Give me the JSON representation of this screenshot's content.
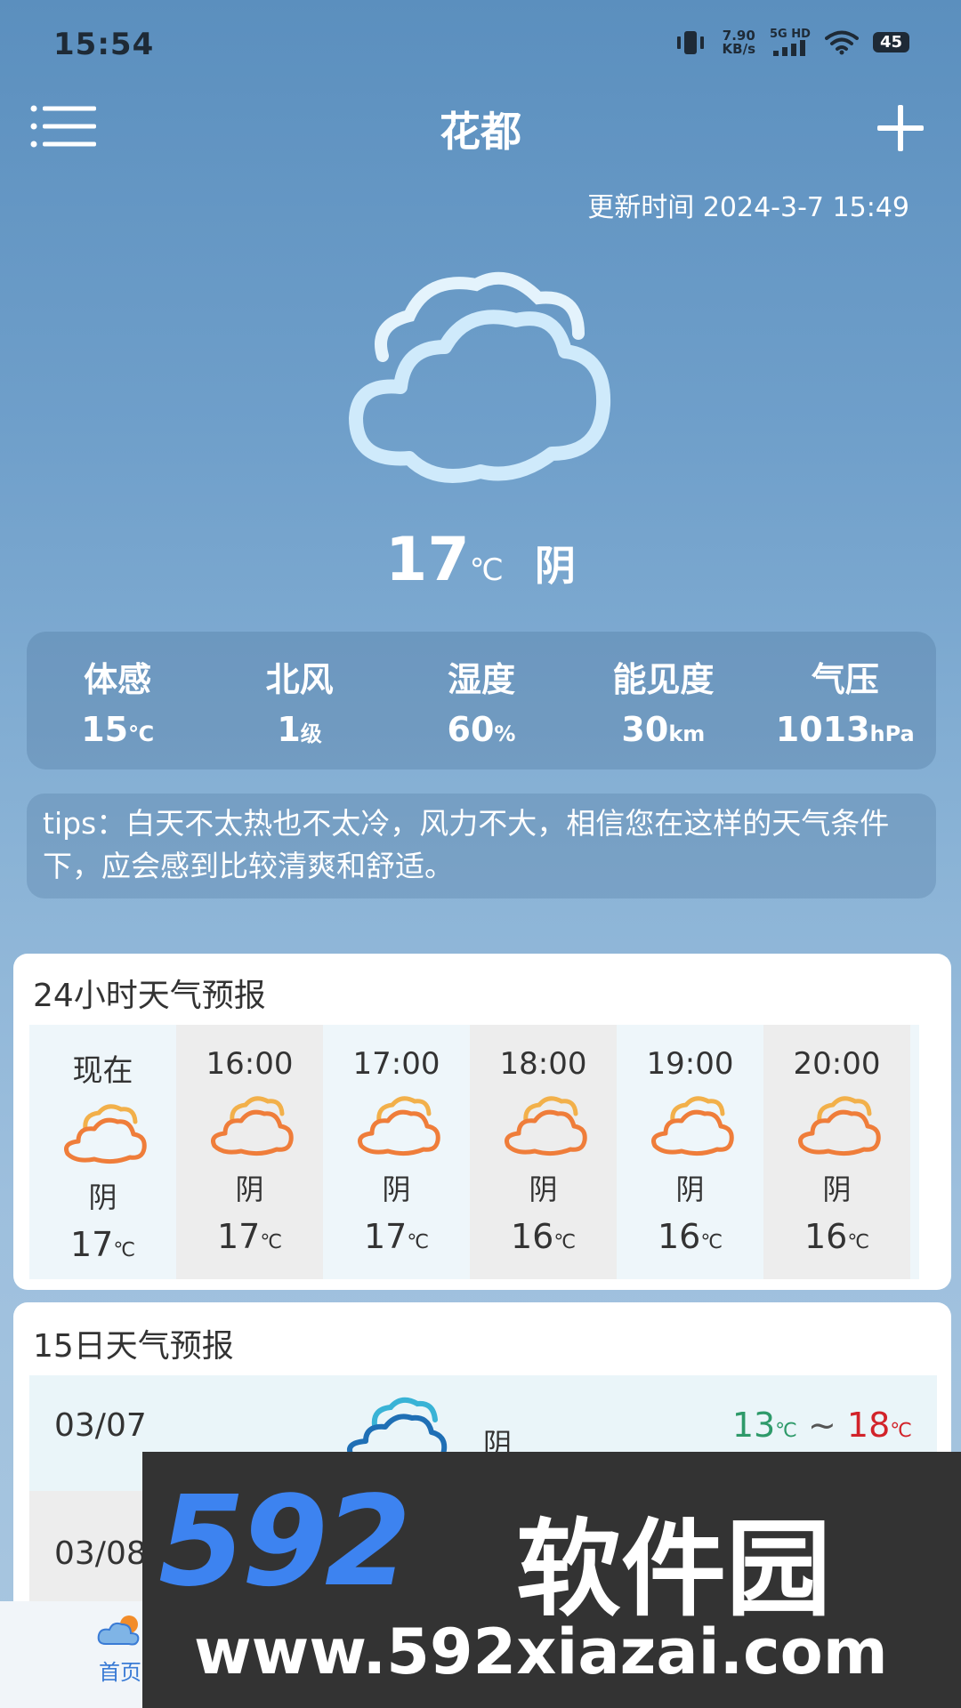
{
  "status_bar": {
    "time": "15:54",
    "net_speed_value": "7.90",
    "net_speed_unit": "KB/s",
    "signal_label": "5G HD",
    "battery": "45"
  },
  "header": {
    "title": "花都",
    "update_time": "更新时间 2024-3-7 15:49"
  },
  "current": {
    "temp": "17",
    "unit": "℃",
    "condition": "阴"
  },
  "details": [
    {
      "label": "体感",
      "value": "15",
      "unit": "℃"
    },
    {
      "label": "北风",
      "value": "1",
      "unit": "级"
    },
    {
      "label": "湿度",
      "value": "60",
      "unit": "%"
    },
    {
      "label": "能见度",
      "value": "30",
      "unit": "km"
    },
    {
      "label": "气压",
      "value": "1013",
      "unit": "hPa"
    }
  ],
  "tips": "tips：白天不太热也不太冷，风力不大，相信您在这样的天气条件下，应会感到比较清爽和舒适。",
  "hourly": {
    "title": "24小时天气预报",
    "items": [
      {
        "time": "现在",
        "cond": "阴",
        "temp": "17",
        "unit": "℃"
      },
      {
        "time": "16:00",
        "cond": "阴",
        "temp": "17",
        "unit": "℃"
      },
      {
        "time": "17:00",
        "cond": "阴",
        "temp": "17",
        "unit": "℃"
      },
      {
        "time": "18:00",
        "cond": "阴",
        "temp": "16",
        "unit": "℃"
      },
      {
        "time": "19:00",
        "cond": "阴",
        "temp": "16",
        "unit": "℃"
      },
      {
        "time": "20:00",
        "cond": "阴",
        "temp": "16",
        "unit": "℃"
      }
    ]
  },
  "daily": {
    "title": "15日天气预报",
    "items": [
      {
        "date": "03/07",
        "cond": "阴",
        "low": "13",
        "high": "18",
        "unit": "℃",
        "sep": "~"
      },
      {
        "date": "03/08"
      }
    ]
  },
  "nav": {
    "home": "首页"
  },
  "watermark": {
    "logo": "592",
    "name": "软件园",
    "url": "www.592xiazai.com"
  },
  "colors": {
    "low_temp": "#2e9a6a",
    "high_temp": "#d2232a",
    "accent": "#3a7bd5"
  }
}
